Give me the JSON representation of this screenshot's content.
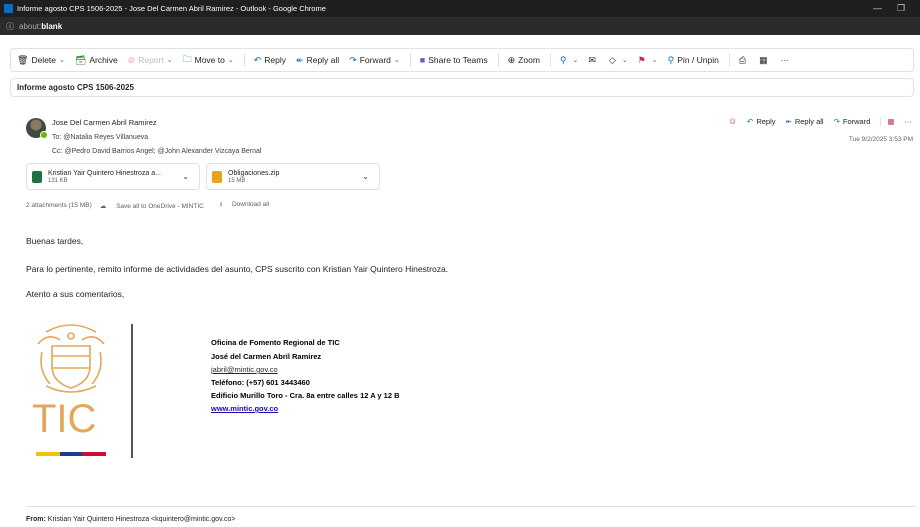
{
  "window": {
    "title": "Informe agosto CPS 1506-2025 - Jose Del Carmen Abril Ramirez - Outlook - Google Chrome",
    "url_scheme": "about:",
    "url_rest": "blank",
    "minimize": "—",
    "restore": "❐"
  },
  "toolbar": {
    "delete": "Delete",
    "archive": "Archive",
    "report": "Report",
    "move_to": "Move to",
    "reply": "Reply",
    "reply_all": "Reply all",
    "forward": "Forward",
    "share_teams": "Share to Teams",
    "zoom": "Zoom",
    "pin": "Pin / Unpin",
    "more": "···"
  },
  "message": {
    "subject": "Informe agosto CPS 1506-2025",
    "sender": "Jose Del Carmen Abril Ramirez",
    "to_label": "To:",
    "to": "Natalia Reyes Villanueva",
    "cc_label": "Cc:",
    "cc": "Pedro David Barrios Angel;",
    "cc2": "John Alexander Vizcaya Bernal",
    "date": "Tue 9/2/2025 3:53 PM",
    "actions": {
      "reply": "Reply",
      "reply_all": "Reply all",
      "forward": "Forward",
      "more": "···"
    }
  },
  "attachments": {
    "items": [
      {
        "name": "Kristian Yair Quintero Hinestroza a...",
        "size": "131 KB",
        "color": "#1e7145"
      },
      {
        "name": "Obligaciones.zip",
        "size": "15 MB",
        "color": "#e8a317"
      }
    ],
    "summary": "2 attachments (15 MB)",
    "save_onedrive": "Save all to OneDrive - MINTIC",
    "download_all": "Download all"
  },
  "body": {
    "greeting": "Buenas tardes,",
    "paragraph": "Para lo pertinente, remito informe de actividades del asunto, CPS suscrito con Kristian Yair Quintero Hinestroza.",
    "closing": "Atento a sus comentarios,"
  },
  "signature": {
    "logo_text": "TIC",
    "office": "Oficina de Fomento Regional de TIC",
    "name": "José del Carmen Abril Ramírez",
    "email": "jabril@mintic.gov.co",
    "phone": "Teléfono: (+57) 601 3443460",
    "address": "Edificio Murillo Toro - Cra. 8a entre calles 12 A y 12 B",
    "website": "www.mintic.gov.co",
    "colors": {
      "gold": "#e3a75a",
      "blue": "#1f3b8f",
      "yellow": "#f2c200",
      "red": "#c8102e"
    }
  },
  "forwarded": {
    "from_label": "From:",
    "from": "Kristian Yair Quintero Hinestroza <kquintero@mintic.gov.co>"
  }
}
